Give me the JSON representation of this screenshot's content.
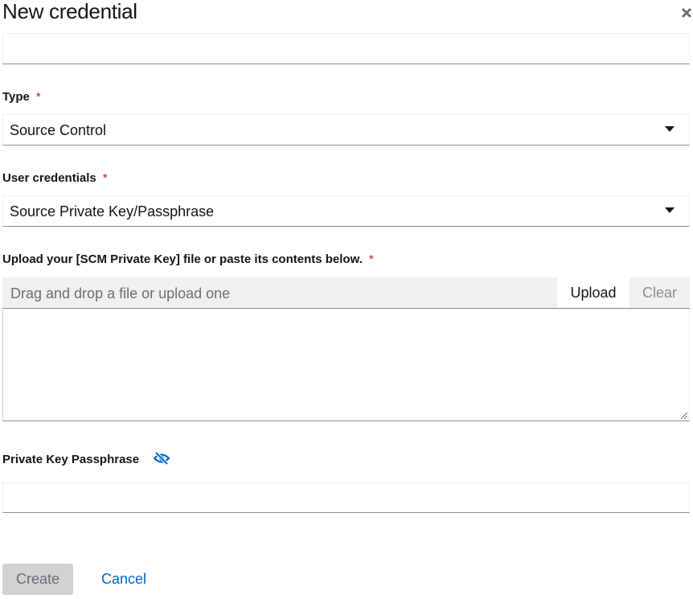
{
  "modal": {
    "title": "New credential",
    "close_icon": "close-icon"
  },
  "fields": {
    "top_input": {
      "value": ""
    },
    "type": {
      "label": "Type",
      "required_mark": "*",
      "selected": "Source Control"
    },
    "user_credentials": {
      "label": "User credentials",
      "required_mark": "*",
      "selected": "Source Private Key/Passphrase"
    },
    "upload": {
      "label": "Upload your [SCM Private Key] file or paste its contents below.",
      "required_mark": "*",
      "placeholder": "Drag and drop a file or upload one",
      "upload_label": "Upload",
      "clear_label": "Clear",
      "contents": ""
    },
    "passphrase": {
      "label": "Private Key Passphrase",
      "toggle_icon": "eye-slash-icon",
      "value": ""
    }
  },
  "actions": {
    "create_label": "Create",
    "cancel_label": "Cancel"
  },
  "colors": {
    "required": "#c9190b",
    "link": "#0066cc",
    "disabled_bg": "#d2d2d2"
  }
}
